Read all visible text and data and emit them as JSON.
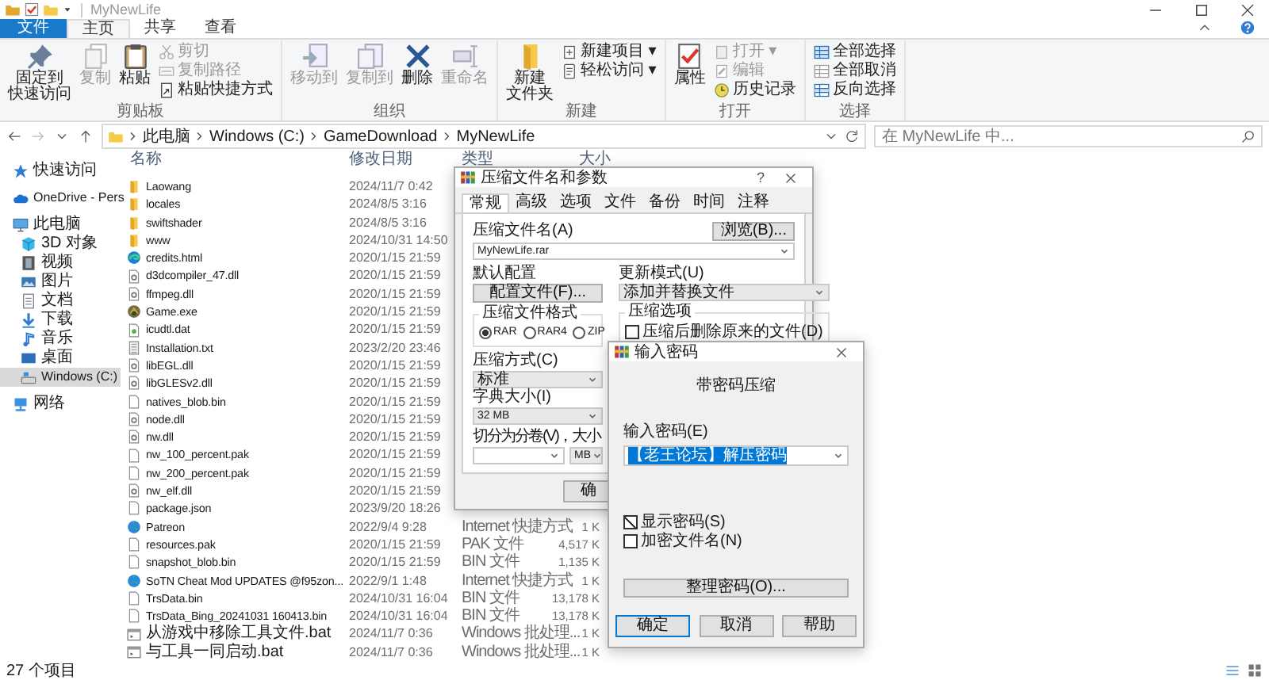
{
  "title_bar": {
    "title": "MyNewLife"
  },
  "ribbon_tabs": [
    {
      "label": "文件",
      "kind": "file",
      "selected": false
    },
    {
      "label": "主页",
      "kind": "tab",
      "selected": true
    },
    {
      "label": "共享",
      "kind": "tab",
      "selected": false
    },
    {
      "label": "查看",
      "kind": "tab",
      "selected": false
    }
  ],
  "ribbon_groups": [
    {
      "label": "剪贴板",
      "items": [
        {
          "kind": "large",
          "lines": [
            "固定到",
            "快速访问"
          ],
          "disabled": false
        },
        {
          "kind": "large",
          "lines": [
            "复制"
          ],
          "disabled": true
        },
        {
          "kind": "large",
          "lines": [
            "粘贴"
          ],
          "disabled": false
        },
        {
          "kind": "stack",
          "items": [
            {
              "label": "剪切",
              "disabled": true
            },
            {
              "label": "复制路径",
              "disabled": true
            },
            {
              "label": "粘贴快捷方式",
              "disabled": false
            }
          ]
        }
      ]
    },
    {
      "label": "组织",
      "items": [
        {
          "kind": "large",
          "lines": [
            "移动到"
          ],
          "disabled": true
        },
        {
          "kind": "large",
          "lines": [
            "复制到"
          ],
          "disabled": true
        },
        {
          "kind": "large",
          "lines": [
            "删除"
          ],
          "disabled": false
        },
        {
          "kind": "large",
          "lines": [
            "重命名"
          ],
          "disabled": true
        }
      ]
    },
    {
      "label": "新建",
      "items": [
        {
          "kind": "large",
          "lines": [
            "新建",
            "文件夹"
          ],
          "disabled": false
        },
        {
          "kind": "stack",
          "items": [
            {
              "label": "新建项目 ▾",
              "disabled": false
            },
            {
              "label": "轻松访问 ▾",
              "disabled": false
            }
          ]
        }
      ]
    },
    {
      "label": "打开",
      "items": [
        {
          "kind": "large",
          "lines": [
            "属性"
          ],
          "disabled": false
        },
        {
          "kind": "stack",
          "items": [
            {
              "label": "打开 ▾",
              "disabled": true
            },
            {
              "label": "编辑",
              "disabled": true
            },
            {
              "label": "历史记录",
              "disabled": false
            }
          ]
        }
      ]
    },
    {
      "label": "选择",
      "items": [
        {
          "kind": "stack",
          "items": [
            {
              "label": "全部选择",
              "disabled": false
            },
            {
              "label": "全部取消",
              "disabled": false
            },
            {
              "label": "反向选择",
              "disabled": false
            }
          ]
        }
      ]
    }
  ],
  "address_bar": {
    "path": [
      "此电脑",
      "Windows (C:)",
      "GameDownload",
      "MyNewLife"
    ]
  },
  "search": {
    "placeholder": "在 MyNewLife 中..."
  },
  "sidebar": {
    "items": [
      {
        "label": "快速访问",
        "selected": false
      },
      {
        "label": "OneDrive - Pers",
        "selected": false
      },
      {
        "label": "此电脑",
        "selected": false,
        "children": [
          {
            "label": "3D 对象",
            "selected": false
          },
          {
            "label": "视频",
            "selected": false
          },
          {
            "label": "图片",
            "selected": false
          },
          {
            "label": "文档",
            "selected": false
          },
          {
            "label": "下载",
            "selected": false
          },
          {
            "label": "音乐",
            "selected": false
          },
          {
            "label": "桌面",
            "selected": false
          },
          {
            "label": "Windows (C:)",
            "selected": true
          }
        ]
      },
      {
        "label": "网络",
        "selected": false
      }
    ]
  },
  "file_list": {
    "columns": [
      "名称",
      "修改日期",
      "类型",
      "大小"
    ],
    "rows": [
      {
        "name": "Laowang",
        "date": "2024/11/7 0:42",
        "kind": "folder"
      },
      {
        "name": "locales",
        "date": "2024/8/5 3:16",
        "kind": "folder"
      },
      {
        "name": "swiftshader",
        "date": "2024/8/5 3:16",
        "kind": "folder"
      },
      {
        "name": "www",
        "date": "2024/10/31 14:50",
        "kind": "folder"
      },
      {
        "name": "credits.html",
        "date": "2020/1/15 21:59",
        "kind": "html"
      },
      {
        "name": "d3dcompiler_47.dll",
        "date": "2020/1/15 21:59",
        "kind": "dll"
      },
      {
        "name": "ffmpeg.dll",
        "date": "2020/1/15 21:59",
        "kind": "dll"
      },
      {
        "name": "Game.exe",
        "date": "2020/1/15 21:59",
        "kind": "exe"
      },
      {
        "name": "icudtl.dat",
        "date": "2020/1/15 21:59",
        "kind": "dat"
      },
      {
        "name": "Installation.txt",
        "date": "2023/2/20 23:46",
        "kind": "txt"
      },
      {
        "name": "libEGL.dll",
        "date": "2020/1/15 21:59",
        "kind": "dll"
      },
      {
        "name": "libGLESv2.dll",
        "date": "2020/1/15 21:59",
        "kind": "dll"
      },
      {
        "name": "natives_blob.bin",
        "date": "2020/1/15 21:59",
        "kind": "file"
      },
      {
        "name": "node.dll",
        "date": "2020/1/15 21:59",
        "kind": "dll"
      },
      {
        "name": "nw.dll",
        "date": "2020/1/15 21:59",
        "kind": "dll"
      },
      {
        "name": "nw_100_percent.pak",
        "date": "2020/1/15 21:59",
        "kind": "file"
      },
      {
        "name": "nw_200_percent.pak",
        "date": "2020/1/15 21:59",
        "kind": "file"
      },
      {
        "name": "nw_elf.dll",
        "date": "2020/1/15 21:59",
        "kind": "dll"
      },
      {
        "name": "package.json",
        "date": "2023/9/20 18:26",
        "kind": "file"
      },
      {
        "name": "Patreon",
        "date": "2022/9/4 9:28",
        "type": "Internet 快捷方式",
        "size": "1 K",
        "kind": "url"
      },
      {
        "name": "resources.pak",
        "date": "2020/1/15 21:59",
        "type": "PAK 文件",
        "size": "4,517 K",
        "kind": "file"
      },
      {
        "name": "snapshot_blob.bin",
        "date": "2020/1/15 21:59",
        "type": "BIN 文件",
        "size": "1,135 K",
        "kind": "file"
      },
      {
        "name": "SoTN Cheat Mod UPDATES @f95zon...",
        "date": "2022/9/1 1:48",
        "type": "Internet 快捷方式",
        "size": "1 K",
        "kind": "url"
      },
      {
        "name": "TrsData.bin",
        "date": "2024/10/31 16:04",
        "type": "BIN 文件",
        "size": "13,178 K",
        "kind": "file"
      },
      {
        "name": "TrsData_Bing_20241031 160413.bin",
        "date": "2024/10/31 16:04",
        "type": "BIN 文件",
        "size": "13,178 K",
        "kind": "file"
      },
      {
        "name": "从游戏中移除工具文件.bat",
        "date": "2024/11/7 0:36",
        "type": "Windows 批处理...",
        "size": "1 K",
        "kind": "bat"
      },
      {
        "name": "与工具一同启动.bat",
        "date": "2024/11/7 0:36",
        "type": "Windows 批处理...",
        "size": "1 K",
        "kind": "bat"
      }
    ]
  },
  "status_bar": {
    "count": "27 个项目"
  },
  "archive_dialog": {
    "title": "压缩文件名和参数",
    "help_label": "?",
    "tabs": [
      {
        "label": "常规",
        "selected": true
      },
      {
        "label": "高级",
        "selected": false
      },
      {
        "label": "选项",
        "selected": false
      },
      {
        "label": "文件",
        "selected": false
      },
      {
        "label": "备份",
        "selected": false
      },
      {
        "label": "时间",
        "selected": false
      },
      {
        "label": "注释",
        "selected": false
      }
    ],
    "archive_name_label": "压缩文件名(A)",
    "browse_button": "浏览(B)...",
    "archive_name": "MyNewLife.rar",
    "profile_label": "默认配置",
    "profile_button": "配置文件(F)...",
    "update_mode_label": "更新模式(U)",
    "update_mode": "添加并替换文件",
    "format_label": "压缩文件格式",
    "formats": [
      {
        "label": "RAR",
        "selected": true
      },
      {
        "label": "RAR4",
        "selected": false
      },
      {
        "label": "ZIP",
        "selected": false
      }
    ],
    "options_label": "压缩选项",
    "options": [
      {
        "label": "压缩后删除原来的文件(D)",
        "checked": false
      }
    ],
    "method_label": "压缩方式(C)",
    "method": "标准",
    "dict_label": "字典大小(I)",
    "dict": "32 MB",
    "split_label": "切分为分卷(V)，大小",
    "split_unit": "MB",
    "ok_button": "确"
  },
  "password_dialog": {
    "title": "输入密码",
    "heading": "带密码压缩",
    "password_label": "输入密码(E)",
    "password": "【老王论坛】解压密码",
    "text_selected": true,
    "show_password": {
      "label": "显示密码(S)",
      "checked": true
    },
    "encrypt_names": {
      "label": "加密文件名(N)",
      "checked": false
    },
    "organize_button": "整理密码(O)...",
    "buttons": [
      {
        "label": "确定",
        "default": true
      },
      {
        "label": "取消",
        "default": false
      },
      {
        "label": "帮助",
        "default": false
      }
    ]
  }
}
